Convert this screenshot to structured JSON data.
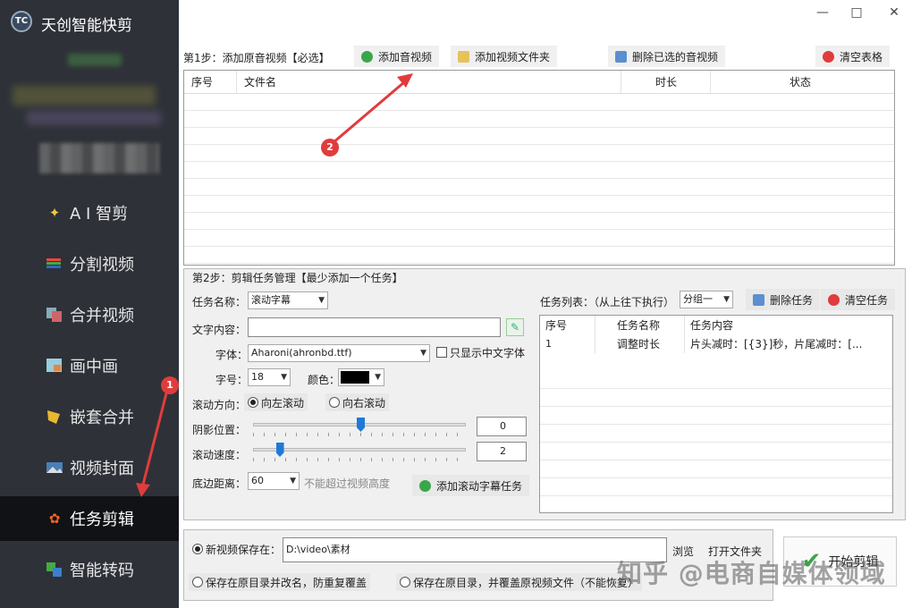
{
  "app": {
    "title": "天创智能快剪",
    "logo_text": "TC"
  },
  "sidebar": {
    "items": [
      {
        "label": "A I 智剪",
        "icon": "ai-icon"
      },
      {
        "label": "分割视频",
        "icon": "split-video-icon"
      },
      {
        "label": "合并视频",
        "icon": "merge-video-icon"
      },
      {
        "label": "画中画",
        "icon": "picture-in-picture-icon"
      },
      {
        "label": "嵌套合并",
        "icon": "nested-merge-icon"
      },
      {
        "label": "视频封面",
        "icon": "video-cover-icon"
      },
      {
        "label": "任务剪辑",
        "icon": "task-edit-icon",
        "active": true
      },
      {
        "label": "智能转码",
        "icon": "transcode-icon"
      }
    ]
  },
  "window": {
    "minimize": "—",
    "maximize": "□",
    "close": "✕"
  },
  "step1": {
    "title": "第1步：添加原音视频【必选】",
    "add_video": "添加音视频",
    "add_folder": "添加视频文件夹",
    "delete_selected": "删除已选的音视频",
    "clear_table": "清空表格",
    "columns": [
      "序号",
      "文件名",
      "时长",
      "状态"
    ]
  },
  "step2": {
    "title": "第2步：剪辑任务管理【最少添加一个任务】",
    "task_name_label": "任务名称：",
    "task_name_value": "滚动字幕",
    "text_label": "文字内容：",
    "text_value": "",
    "font_label": "字体：",
    "font_value": "Aharoni(ahronbd.ttf)",
    "chinese_only_label": "只显示中文字体",
    "size_label": "字号：",
    "size_value": "18",
    "color_label": "颜色：",
    "direction_label": "滚动方向：",
    "dir_left": "向左滚动",
    "dir_right": "向右滚动",
    "shadow_label": "阴影位置：",
    "shadow_value": "0",
    "shadow_level": 0.5,
    "speed_label": "滚动速度：",
    "speed_value": "2",
    "speed_level": 0.12,
    "bottom_label": "底边距离：",
    "bottom_value": "60",
    "bottom_hint": "不能超过视频高度",
    "add_task": "添加滚动字幕任务",
    "task_list_label": "任务列表：（从上往下执行）",
    "group_value": "分组一",
    "delete_task": "删除任务",
    "clear_tasks": "清空任务",
    "task_columns": [
      "序号",
      "任务名称",
      "任务内容"
    ],
    "tasks": [
      {
        "no": "1",
        "name": "调整时长",
        "content": "片头减时：[{3}]秒，片尾减时：[..."
      }
    ]
  },
  "output": {
    "save_new_label": "新视频保存在：",
    "path": "D:\\video\\素材",
    "browse": "浏览",
    "open_folder": "打开文件夹",
    "option_rename": "保存在原目录并改名，防重复覆盖",
    "option_overwrite": "保存在原目录，并覆盖原视频文件（不能恢复）",
    "start": "开始剪辑"
  },
  "annotations": {
    "badge1": "1",
    "badge2": "2"
  },
  "watermark": "知乎 @电商自媒体领域",
  "colors": {
    "sidebar_bg": "#2e3138",
    "active_bg": "#111215",
    "badge": "#e03c3c",
    "slider_thumb": "#1e7ad6"
  }
}
